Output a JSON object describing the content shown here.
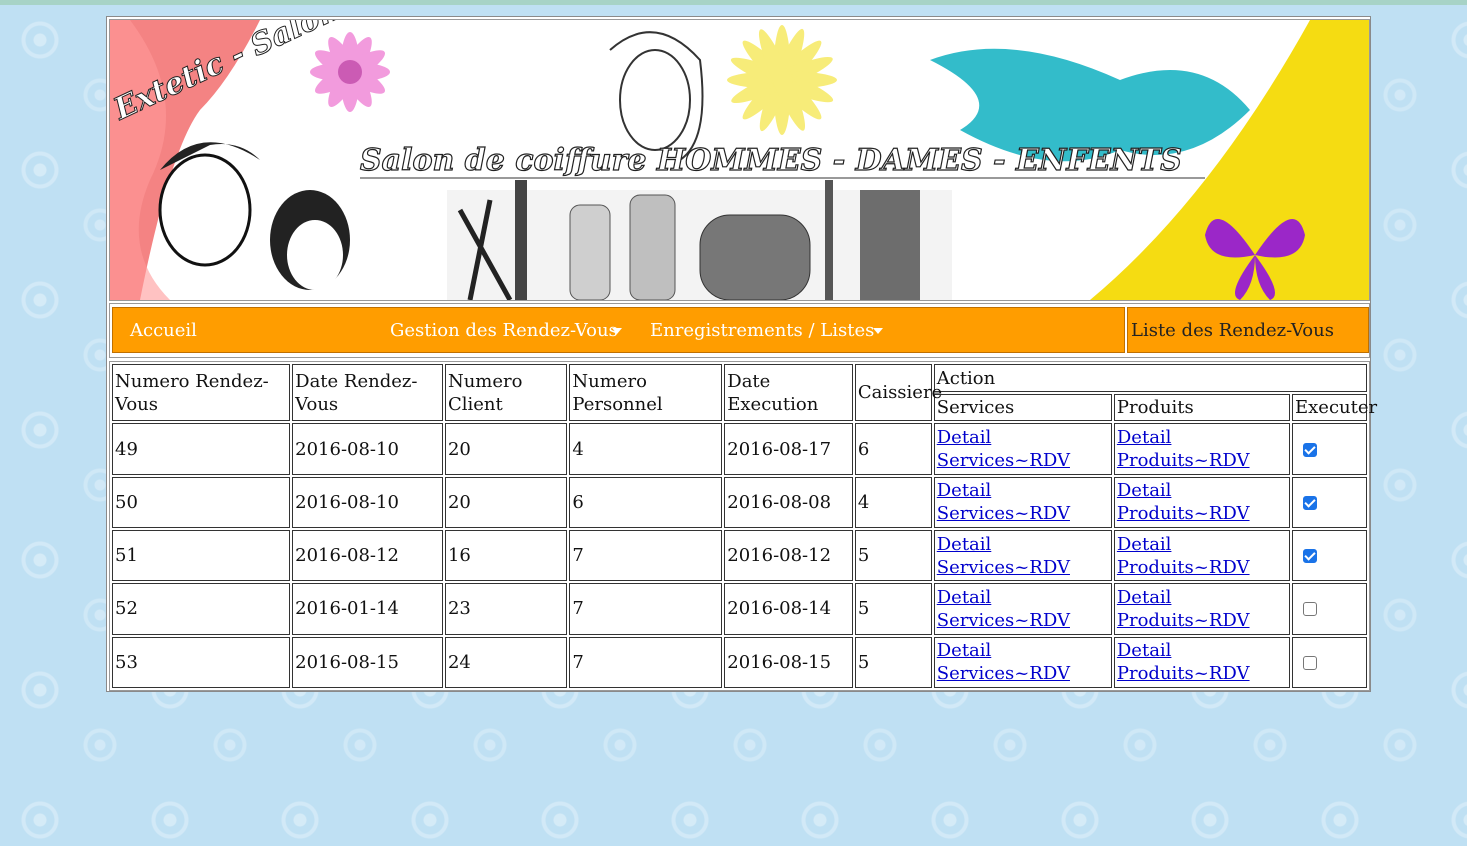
{
  "banner": {
    "brand": "Extetic - Salon",
    "headline": "Salon de coiffure HOMMES - DAMES - ENFENTS"
  },
  "nav": {
    "home": "Accueil",
    "appointments": "Gestion des Rendez-Vous",
    "records": "Enregistrements / Listes",
    "current_page": "Liste des Rendez-Vous"
  },
  "table": {
    "headers": {
      "id": "Numero Rendez-Vous",
      "date": "Date Rendez-Vous",
      "client": "Numero Client",
      "staff": "Numero Personnel",
      "exec_date": "Date Execution",
      "cashier": "Caissiere",
      "action": "Action",
      "services": "Services",
      "products": "Produits",
      "execute": "Executer"
    },
    "link_services": [
      "Detail",
      "Services~RDV"
    ],
    "link_products": [
      "Detail",
      "Produits~RDV"
    ],
    "rows": [
      {
        "id": "49",
        "date": "2016-08-10",
        "client": "20",
        "staff": "4",
        "exec_date": "2016-08-17",
        "cashier": "6",
        "executed": true
      },
      {
        "id": "50",
        "date": "2016-08-10",
        "client": "20",
        "staff": "6",
        "exec_date": "2016-08-08",
        "cashier": "4",
        "executed": true
      },
      {
        "id": "51",
        "date": "2016-08-12",
        "client": "16",
        "staff": "7",
        "exec_date": "2016-08-12",
        "cashier": "5",
        "executed": true
      },
      {
        "id": "52",
        "date": "2016-01-14",
        "client": "23",
        "staff": "7",
        "exec_date": "2016-08-14",
        "cashier": "5",
        "executed": false
      },
      {
        "id": "53",
        "date": "2016-08-15",
        "client": "24",
        "staff": "7",
        "exec_date": "2016-08-15",
        "cashier": "5",
        "executed": false
      }
    ]
  }
}
